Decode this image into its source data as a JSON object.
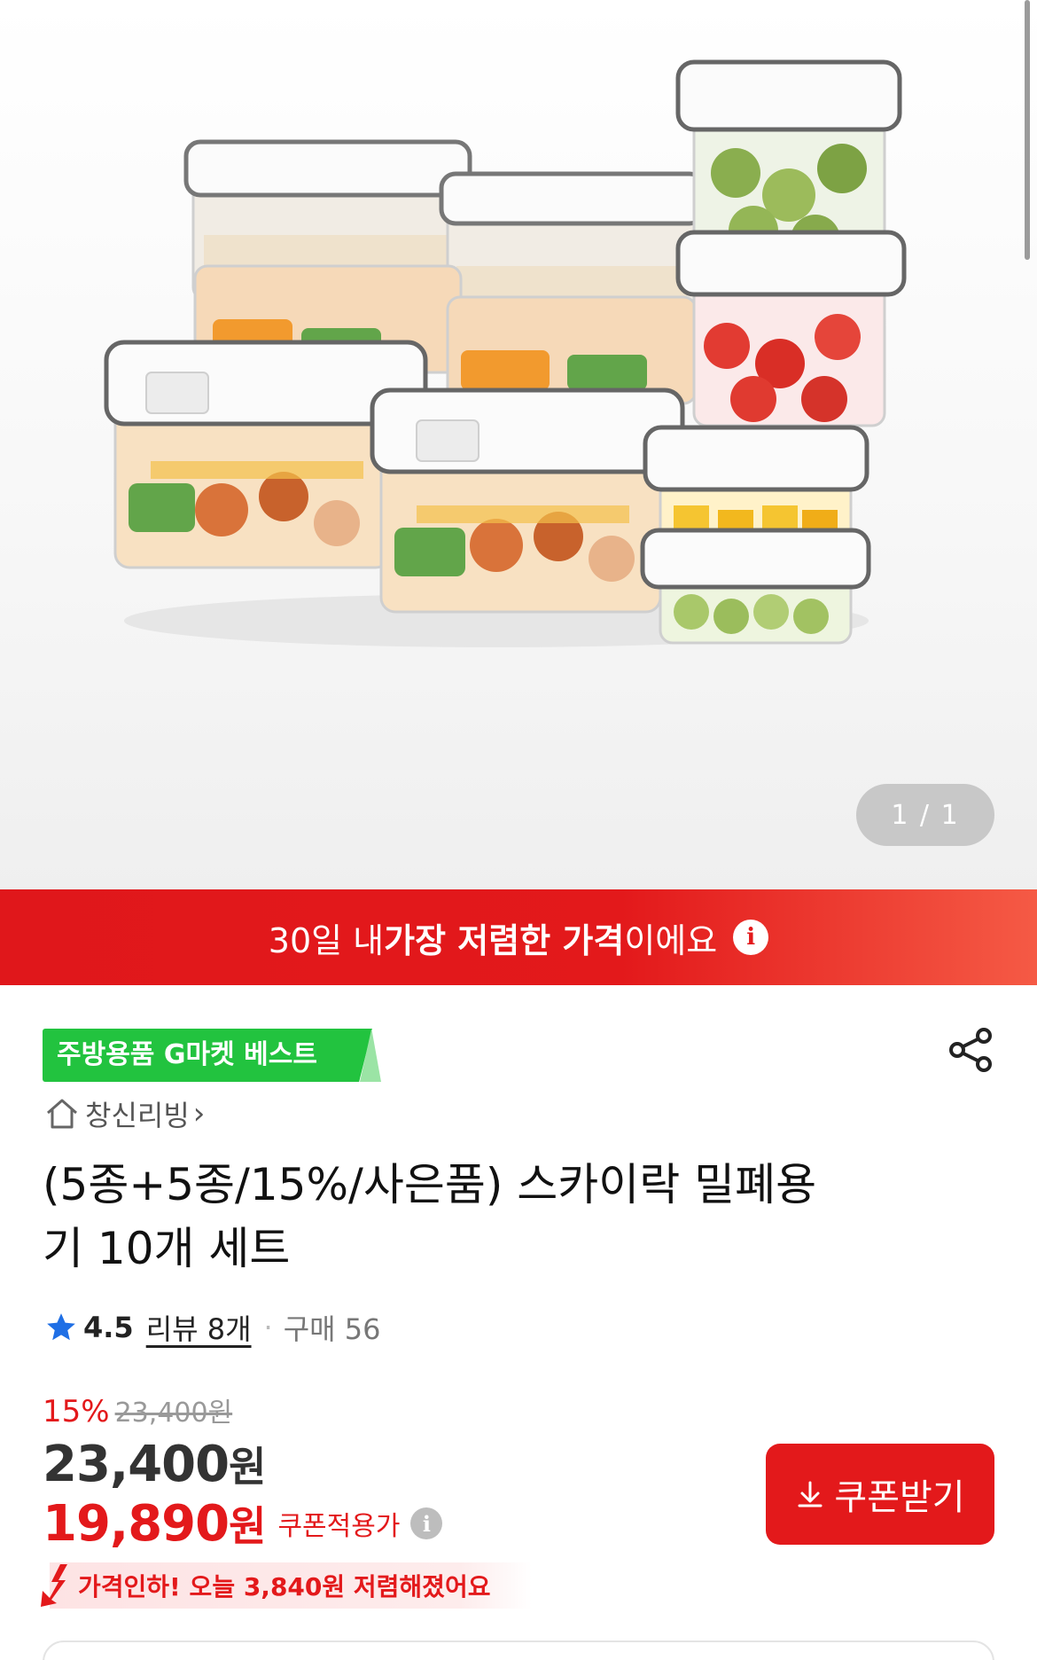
{
  "hero": {
    "counter": "1 / 1",
    "image_description_icon": "food-containers-photo"
  },
  "banner": {
    "prefix": "30일 내 ",
    "strong": "가장 저렴한 가격",
    "suffix": "이에요",
    "info_glyph": "i"
  },
  "badge": {
    "label": "주방용품 G마켓 베스트"
  },
  "store": {
    "name": "창신리빙",
    "chevron": "›"
  },
  "product": {
    "title_line1": "(5종+5종/15%/사은품) 스카이락 밀폐용",
    "title_line2": "기 10개 세트"
  },
  "rating": {
    "score": "4.5",
    "review": "리뷰 8개",
    "dot": "·",
    "purchases": "구매 56"
  },
  "price": {
    "discount_pct": "15%",
    "original": "23,400원",
    "current_num": "23,400",
    "current_unit": "원",
    "coupon_num": "19,890",
    "coupon_unit": "원",
    "coupon_label": "쿠폰적용가",
    "help_glyph": "i"
  },
  "coupon_button": {
    "label": "쿠폰받기"
  },
  "price_drop": {
    "text": "가격인하! 오늘 3,840원 저렴해졌어요"
  },
  "colors": {
    "accent_red": "#e3191b",
    "badge_green": "#22c33f"
  }
}
